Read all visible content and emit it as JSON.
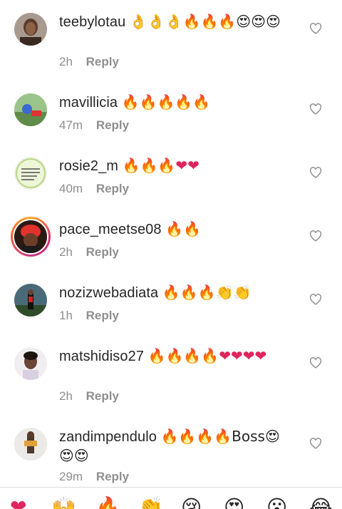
{
  "comments": [
    {
      "username": "teebylotau",
      "text": "👌👌👌🔥🔥🔥😍😍😍",
      "time": "2h",
      "reply": "Reply"
    },
    {
      "username": "mavillicia",
      "text": "🔥🔥🔥🔥🔥",
      "time": "47m",
      "reply": "Reply"
    },
    {
      "username": "rosie2_m",
      "text": "🔥🔥🔥❤❤",
      "time": "40m",
      "reply": "Reply"
    },
    {
      "username": "pace_meetse08",
      "text": "🔥🔥",
      "time": "2h",
      "reply": "Reply"
    },
    {
      "username": "nozizwebadiata",
      "text": "🔥🔥🔥👏👏",
      "time": "1h",
      "reply": "Reply"
    },
    {
      "username": "matshidiso27",
      "text": "🔥🔥🔥🔥❤❤❤❤",
      "time": "2h",
      "reply": "Reply"
    },
    {
      "username": "zandimpendulo",
      "text": "🔥🔥🔥🔥Boss😍😍😍",
      "time": "29m",
      "reply": "Reply"
    }
  ],
  "quick_reactions": [
    "❤",
    "🙌",
    "🔥",
    "👏",
    "😢",
    "😍",
    "😮",
    "😂"
  ],
  "icons": {
    "like": "heart-outline-icon"
  },
  "colors": {
    "text": "#262626",
    "meta": "#8e8e8e",
    "heart_outline": "#8e8e8e"
  }
}
